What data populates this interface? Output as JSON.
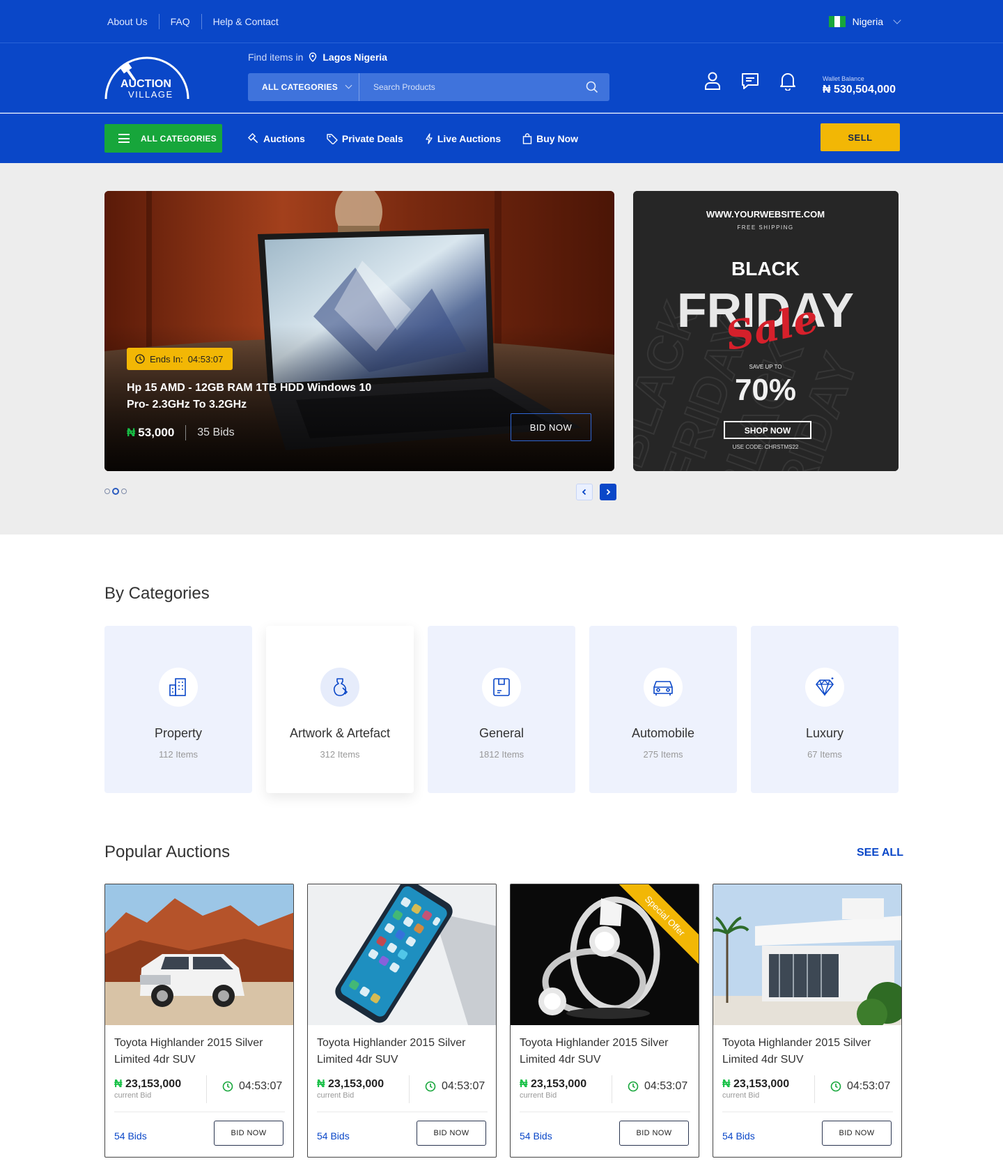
{
  "topbar": {
    "links": [
      "About Us",
      "FAQ",
      "Help & Contact"
    ],
    "country": "Nigeria",
    "flag_colors": [
      "#17a63b",
      "#ffffff",
      "#17a63b"
    ]
  },
  "header": {
    "logo_line1": "AUCTION",
    "logo_line2": "VILLAGE",
    "find_label": "Find items in",
    "location": "Lagos Nigeria",
    "category_select": "ALL CATEGORIES",
    "search_placeholder": "Search Products",
    "wallet_label": "Wallet Balance",
    "wallet_amount": "₦ 530,504,000"
  },
  "nav": {
    "all_categories": "ALL CATEGORIES",
    "links": [
      "Auctions",
      "Private Deals",
      "Live Auctions",
      "Buy Now"
    ],
    "sell": "SELL"
  },
  "hero": {
    "ends_in_label": "Ends In:",
    "ends_in_time": "04:53:07",
    "title": "Hp 15 AMD - 12GB RAM 1TB HDD Windows 10 Pro- 2.3GHz To 3.2GHz",
    "currency": "₦",
    "price": "53,000",
    "bids": "35 Bids",
    "bid_button": "BID NOW",
    "slides_count": 3,
    "active_slide": 2
  },
  "promo": {
    "website": "WWW.YOURWEBSITE.COM",
    "shipping": "FREE SHIPPING",
    "line1": "BLACK",
    "line2": "FRIDAY",
    "script": "Sale",
    "save_label": "SAVE UP TO",
    "percent": "70%",
    "button": "SHOP NOW",
    "code": "USE CODE: CHRSTMS22"
  },
  "categories": {
    "title": "By Categories",
    "items": [
      {
        "name": "Property",
        "count": "112 Items",
        "icon": "building-icon"
      },
      {
        "name": "Artwork & Artefact",
        "count": "312 Items",
        "icon": "vase-icon"
      },
      {
        "name": "General",
        "count": "1812 Items",
        "icon": "box-icon"
      },
      {
        "name": "Automobile",
        "count": "275 Items",
        "icon": "car-icon"
      },
      {
        "name": "Luxury",
        "count": "67 Items",
        "icon": "diamond-icon"
      }
    ]
  },
  "popular": {
    "title": "Popular Auctions",
    "see_all": "SEE ALL",
    "items": [
      {
        "title": "Toyota Highlander 2015 Silver Limited 4dr SUV",
        "price": "23,153,000",
        "price_label": "current Bid",
        "time": "04:53:07",
        "bids": "54 Bids",
        "button": "BID NOW"
      },
      {
        "title": "Toyota Highlander 2015 Silver Limited 4dr SUV",
        "price": "23,153,000",
        "price_label": "current Bid",
        "time": "04:53:07",
        "bids": "54 Bids",
        "button": "BID NOW"
      },
      {
        "title": "Toyota Highlander 2015 Silver Limited 4dr SUV",
        "price": "23,153,000",
        "price_label": "current Bid",
        "time": "04:53:07",
        "bids": "54 Bids",
        "button": "BID NOW",
        "ribbon": "Special Offer"
      },
      {
        "title": "Toyota Highlander 2015 Silver Limited 4dr SUV",
        "price": "23,153,000",
        "price_label": "current Bid",
        "time": "04:53:07",
        "bids": "54 Bids",
        "button": "BID NOW"
      }
    ]
  },
  "colors": {
    "brand_blue": "#0a47c8",
    "accent_green": "#17a63b",
    "accent_yellow": "#f2b705"
  }
}
